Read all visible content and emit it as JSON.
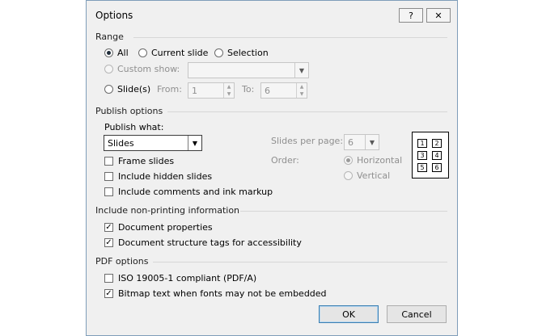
{
  "dialog": {
    "title": "Options",
    "help_glyph": "?",
    "close_glyph": "✕"
  },
  "range": {
    "heading": "Range",
    "all": "All",
    "current_slide": "Current slide",
    "selection": "Selection",
    "custom_show": "Custom show:",
    "slides": "Slide(s)",
    "from_label": "From:",
    "from_value": "1",
    "to_label": "To:",
    "to_value": "6",
    "selected": "All"
  },
  "publish": {
    "heading": "Publish options",
    "publish_what_label": "Publish what:",
    "publish_what_value": "Slides",
    "frame_slides": "Frame slides",
    "include_hidden": "Include hidden slides",
    "include_comments": "Include comments and ink markup",
    "slides_per_page_label": "Slides per page:",
    "slides_per_page_value": "6",
    "order_label": "Order:",
    "horizontal": "Horizontal",
    "vertical": "Vertical",
    "preview_cells": [
      "1",
      "2",
      "3",
      "4",
      "5",
      "6"
    ]
  },
  "nonprinting": {
    "heading": "Include non-printing information",
    "doc_properties": "Document properties",
    "doc_structure_tags": "Document structure tags for accessibility"
  },
  "pdf": {
    "heading": "PDF options",
    "iso": "ISO 19005-1 compliant (PDF/A)",
    "bitmap_text": "Bitmap text when fonts may not be embedded"
  },
  "buttons": {
    "ok": "OK",
    "cancel": "Cancel"
  },
  "glyphs": {
    "check": "✓",
    "dropdown": "▼",
    "spin_up": "▲",
    "spin_down": "▼"
  }
}
